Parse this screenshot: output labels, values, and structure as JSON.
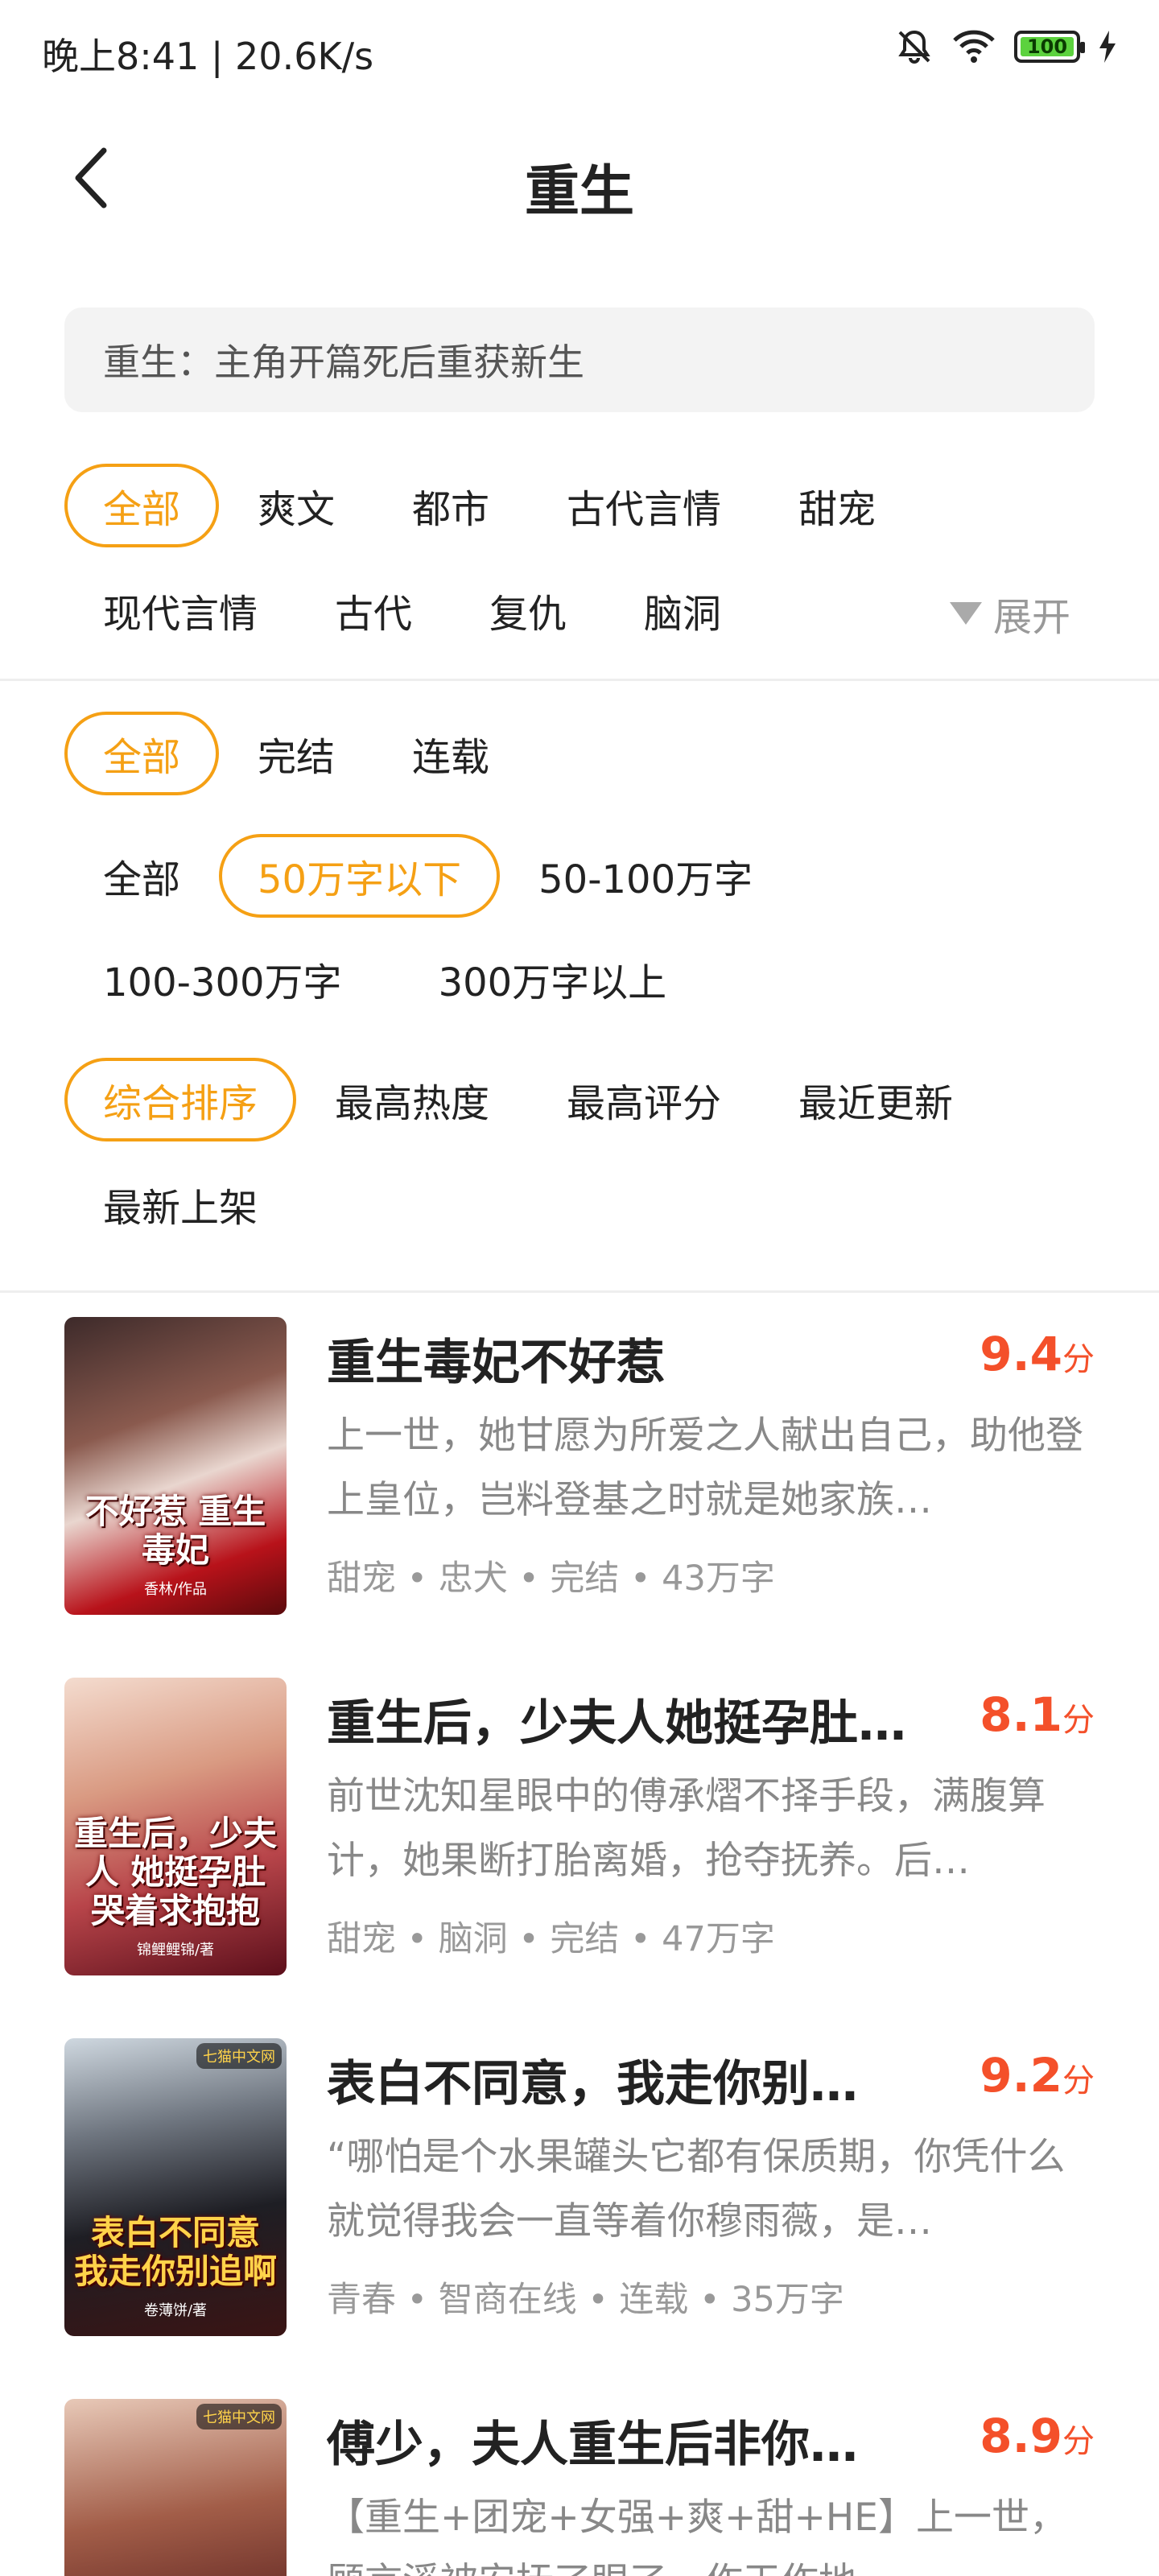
{
  "status_bar": {
    "time_speed": "晚上8:41 | 20.6K/s",
    "battery": "100",
    "icons": [
      "mute-bell-icon",
      "wifi-icon",
      "battery-icon",
      "charging-icon"
    ]
  },
  "header": {
    "title": "重生",
    "back_icon": "chevron-left-icon"
  },
  "description": "重生：主角开篇死后重获新生",
  "accent_color": "#f5a014",
  "score_color": "#f4502a",
  "filters": {
    "genre_row1": [
      "全部",
      "爽文",
      "都市",
      "古代言情",
      "甜宠"
    ],
    "genre_row2": [
      "现代言情",
      "古代",
      "复仇",
      "脑洞"
    ],
    "expand_label": "展开",
    "status": [
      "全部",
      "完结",
      "连载"
    ],
    "length_row1": [
      "全部",
      "50万字以下",
      "50-100万字"
    ],
    "length_row2": [
      "100-300万字",
      "300万字以上"
    ],
    "sort_row1": [
      "综合排序",
      "最高热度",
      "最高评分",
      "最近更新"
    ],
    "sort_row2": [
      "最新上架"
    ],
    "selected": {
      "genre": "全部",
      "status": "全部",
      "length": "50万字以下",
      "sort": "综合排序"
    }
  },
  "books": [
    {
      "title": "重生毒妃不好惹",
      "score": "9.4",
      "score_unit": "分",
      "description": "上一世，她甘愿为所爱之人献出自己，助他登上皇位，岂料登基之时就是她家族…",
      "meta": "甜宠 • 忠犬 • 完结 • 43万字",
      "cover_title": "不好惹 重生毒妃",
      "cover_sub": "香林/作品",
      "cover_badge": ""
    },
    {
      "title": "重生后，少夫人她挺孕肚…",
      "score": "8.1",
      "score_unit": "分",
      "description": "前世沈知星眼中的傅承熠不择手段，满腹算计，她果断打胎离婚，抢夺抚养。后…",
      "meta": "甜宠 • 脑洞 • 完结 • 47万字",
      "cover_title": "重生后，少夫人 她挺孕肚 哭着求抱抱",
      "cover_sub": "锦鲤鲤锦/著",
      "cover_badge": ""
    },
    {
      "title": "表白不同意，我走你别…",
      "score": "9.2",
      "score_unit": "分",
      "description": "“哪怕是个水果罐头它都有保质期，你凭什么就觉得我会一直等着你穆雨薇，是…",
      "meta": "青春 • 智商在线 • 连载 • 35万字",
      "cover_title": "表白不同意 我走你别追啊",
      "cover_sub": "卷薄饼/著",
      "cover_badge": "七猫中文网"
    },
    {
      "title": "傅少，夫人重生后非你…",
      "score": "8.9",
      "score_unit": "分",
      "description": "【重生+团宠+女强+爽+甜+HE】上一世，顾言溪被安抚了眼了，作天作地…",
      "meta": "",
      "cover_title": "",
      "cover_sub": "",
      "cover_badge": "七猫中文网"
    }
  ]
}
